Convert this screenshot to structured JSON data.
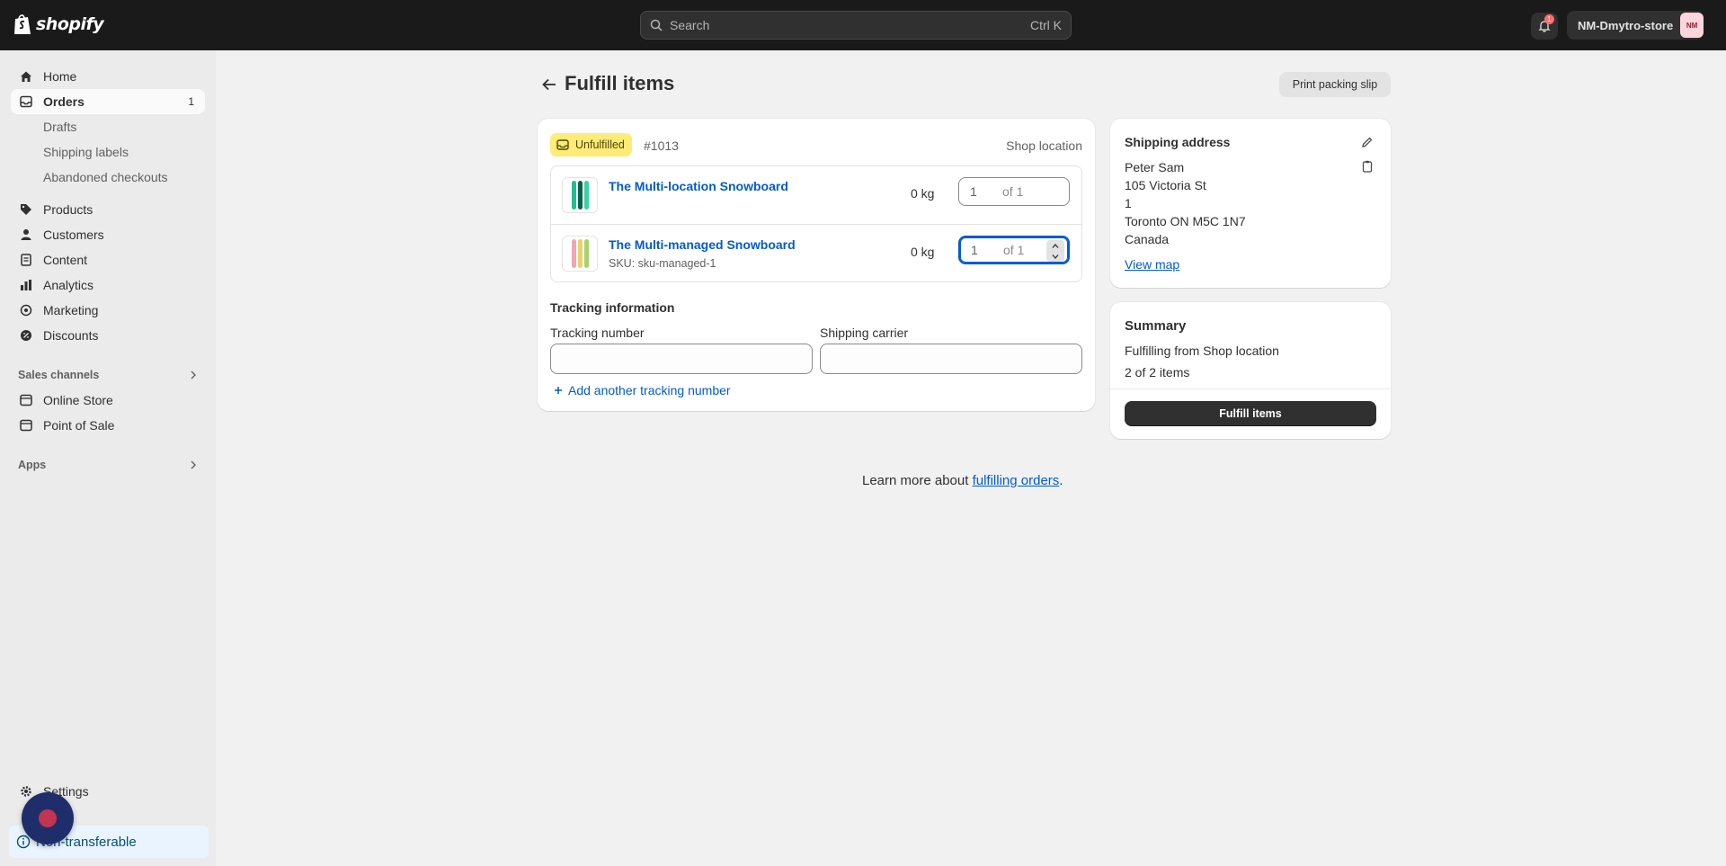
{
  "topbar": {
    "logo_text": "shopify",
    "search_placeholder": "Search",
    "search_shortcut": "Ctrl K",
    "notification_count": "1",
    "store_name": "NM-Dmytro-store",
    "avatar_initials": "NM"
  },
  "sidebar": {
    "home": "Home",
    "orders": "Orders",
    "orders_count": "1",
    "drafts": "Drafts",
    "shipping_labels": "Shipping labels",
    "abandoned_checkouts": "Abandoned checkouts",
    "products": "Products",
    "customers": "Customers",
    "content": "Content",
    "analytics": "Analytics",
    "marketing": "Marketing",
    "discounts": "Discounts",
    "sales_channels": "Sales channels",
    "online_store": "Online Store",
    "point_of_sale": "Point of Sale",
    "apps": "Apps",
    "settings": "Settings",
    "non_transferable": "Non-transferable"
  },
  "page": {
    "title": "Fulfill items",
    "print_button": "Print packing slip"
  },
  "fulfillment": {
    "status_badge": "Unfulfilled",
    "order_number": "#1013",
    "location": "Shop location",
    "items": [
      {
        "title": "The Multi-location Snowboard",
        "sku": "",
        "weight": "0 kg",
        "quantity": "1",
        "of_total": "of 1"
      },
      {
        "title": "The Multi-managed Snowboard",
        "sku": "SKU: sku-managed-1",
        "weight": "0 kg",
        "quantity": "1",
        "of_total": "of 1"
      }
    ],
    "tracking_header": "Tracking information",
    "tracking_number_label": "Tracking number",
    "tracking_number_value": "",
    "shipping_carrier_label": "Shipping carrier",
    "shipping_carrier_value": "",
    "add_tracking": "Add another tracking number"
  },
  "shipping_address": {
    "header": "Shipping address",
    "lines": [
      "Peter Sam",
      "105 Victoria St",
      "1",
      "Toronto ON M5C 1N7",
      "Canada"
    ],
    "view_map": "View map"
  },
  "summary": {
    "header": "Summary",
    "fulfilling_from": "Fulfilling from Shop location",
    "items_count": "2 of 2 items",
    "fulfill_button": "Fulfill items"
  },
  "footer": {
    "learn_prefix": "Learn more about ",
    "learn_link": "fulfilling orders",
    "learn_suffix": "."
  },
  "colors": {
    "topbar": "#1a1a1a",
    "link": "#005bd3",
    "badge": "#ffeb78",
    "primary_button": "#303030"
  }
}
